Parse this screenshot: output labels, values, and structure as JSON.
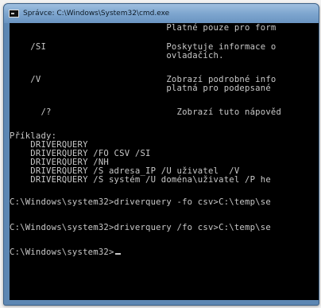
{
  "window": {
    "title": "Správce: C:\\Windows\\System32\\cmd.exe",
    "icon": "cmd-icon"
  },
  "console": {
    "lines": [
      "                              Platné pouze pro form",
      "",
      "    /SI                       Poskytuje informace o",
      "                              ovladačích.",
      "",
      "    /V                        Zobrazí podrobné info",
      "                              platná pro podepsané",
      "",
      "      /?                        Zobrazí tuto nápověd",
      "",
      "Příklady:",
      "    DRIVERQUERY",
      "    DRIVERQUERY /FO CSV /SI",
      "    DRIVERQUERY /NH",
      "    DRIVERQUERY /S adresa_IP /U uživatel  /V",
      "    DRIVERQUERY /S systém /U doména\\uživatel /P he",
      "",
      "C:\\Windows\\system32>driverquery -fo csv>C:\\temp\\se",
      "",
      "C:\\Windows\\system32>driverquery /fo csv>C:\\temp\\se",
      "",
      "C:\\Windows\\system32>"
    ]
  }
}
